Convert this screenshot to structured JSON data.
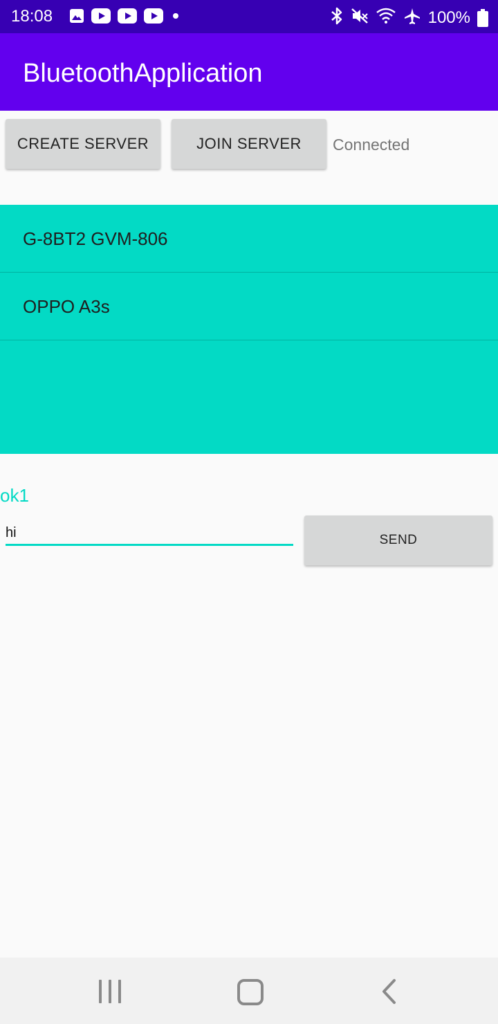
{
  "status_bar": {
    "time": "18:08",
    "battery": "100%",
    "left_icons": [
      "gallery-icon",
      "youtube-icon",
      "youtube-icon",
      "youtube-icon",
      "notification-dot-icon"
    ],
    "right_icons": [
      "bluetooth-icon",
      "mute-icon",
      "wifi-icon",
      "airplane-mode-icon",
      "battery-icon"
    ]
  },
  "app_bar": {
    "title": "BluetoothApplication"
  },
  "controls": {
    "create_server_label": "CREATE SERVER",
    "join_server_label": "JOIN SERVER",
    "connection_status": "Connected"
  },
  "devices": [
    {
      "name": "G-8BT2 GVM-806"
    },
    {
      "name": "OPPO A3s"
    }
  ],
  "messaging": {
    "received_message": "ok1",
    "input_value": "hi",
    "send_label": "SEND"
  },
  "navigation_bar": {
    "icons": [
      "recent-apps-icon",
      "home-icon",
      "back-icon"
    ]
  },
  "colors": {
    "status_bar": "#3700b3",
    "app_bar": "#6200ee",
    "accent": "#03dac5",
    "button": "#d6d7d7"
  }
}
